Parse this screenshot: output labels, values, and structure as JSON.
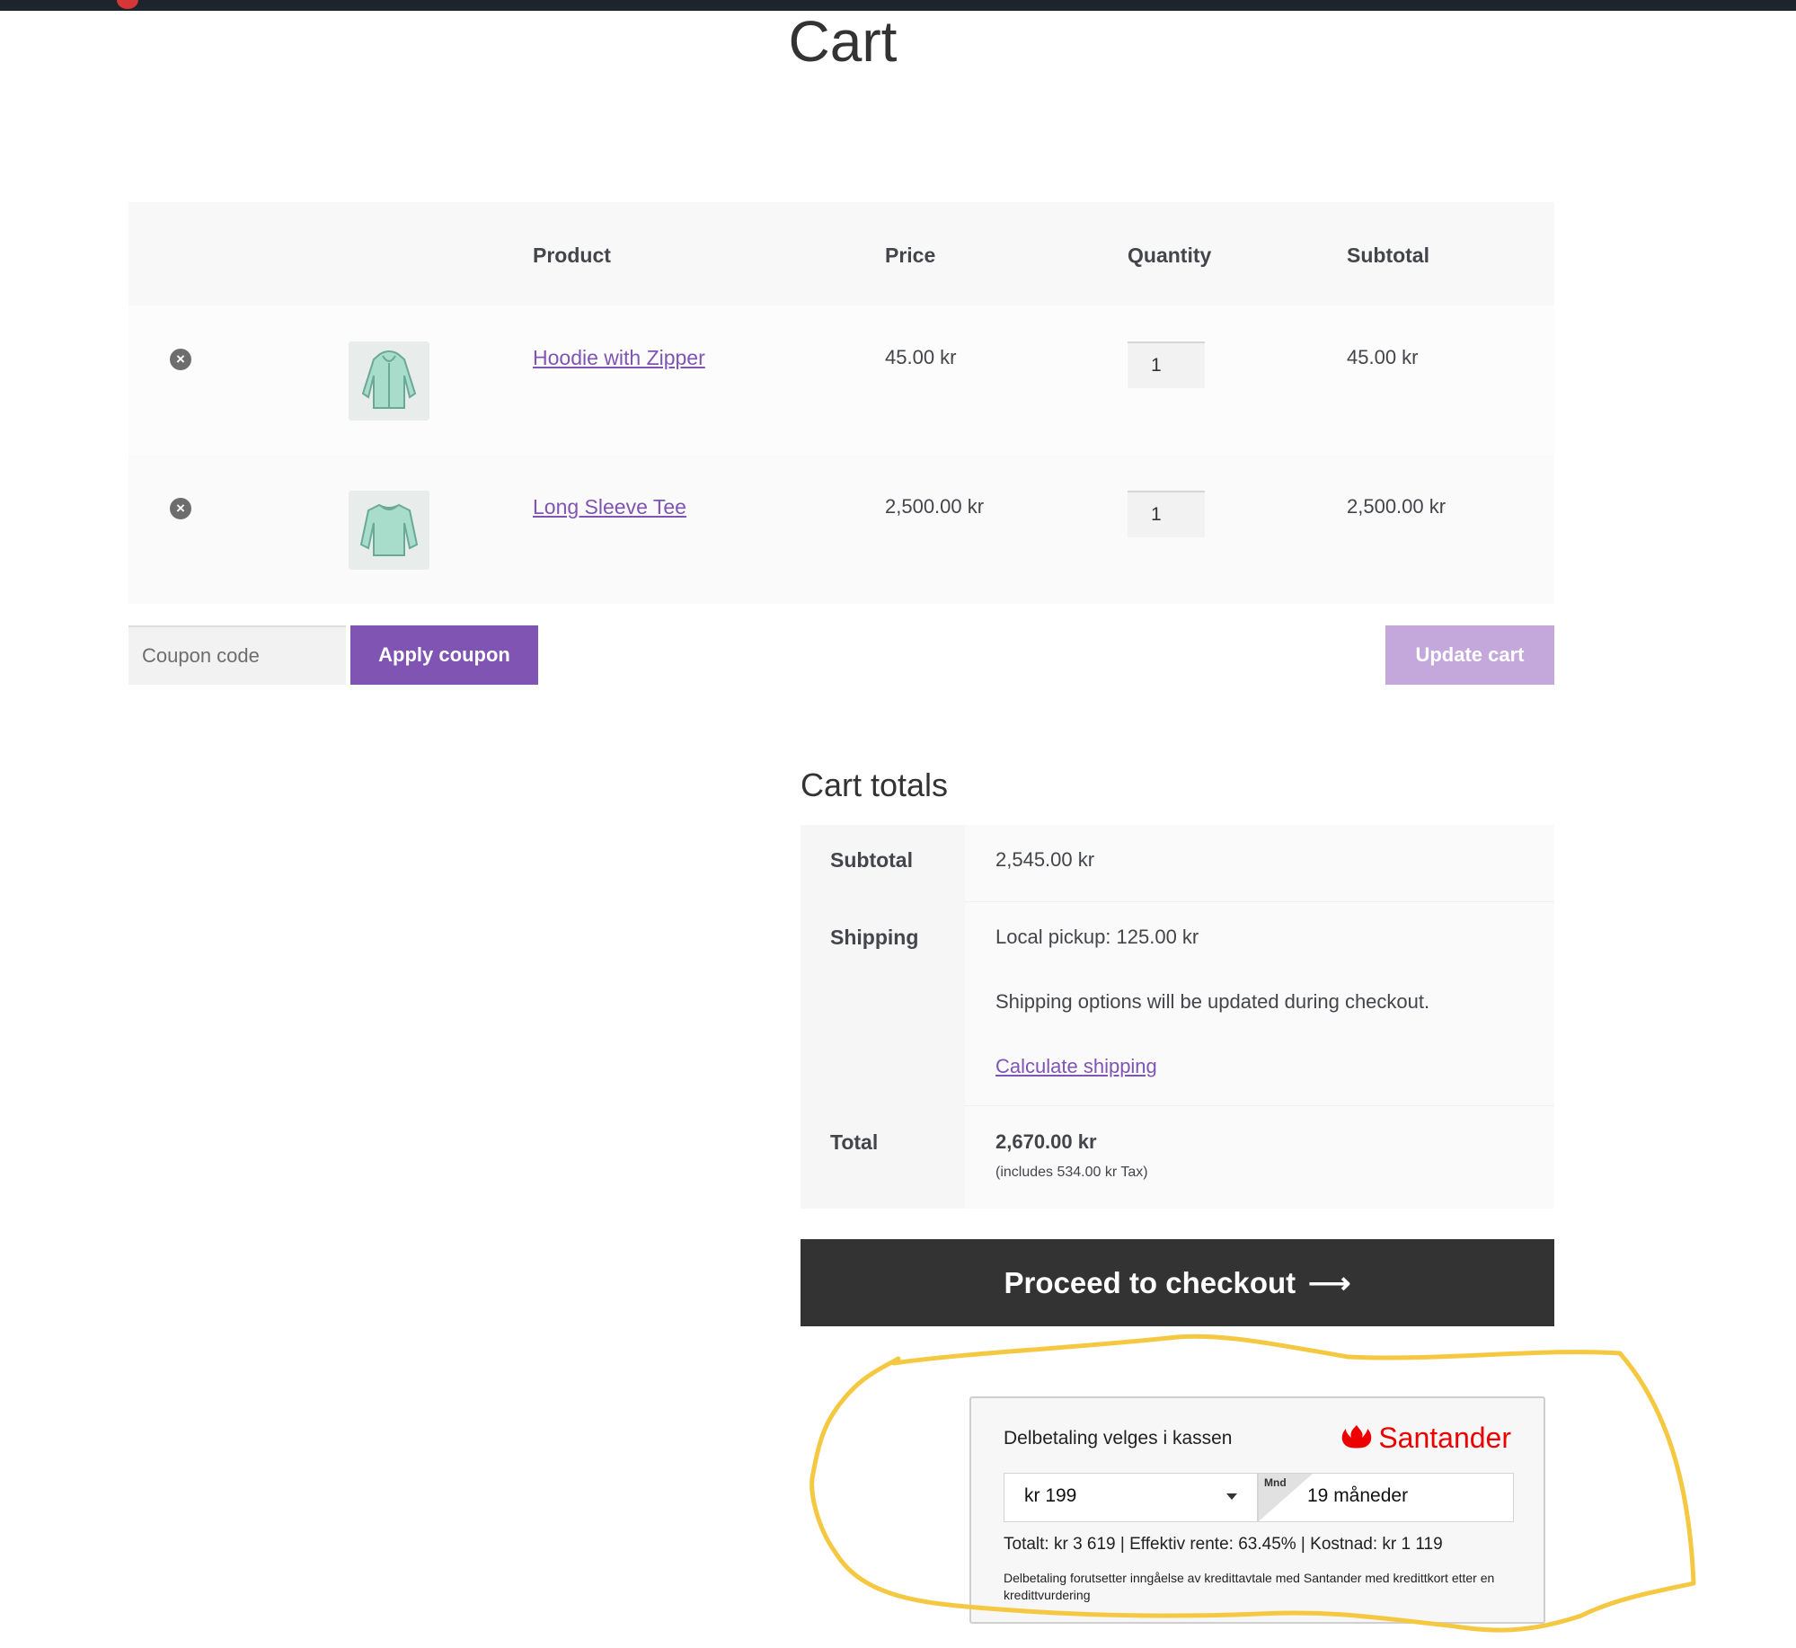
{
  "page": {
    "title": "Cart"
  },
  "cart": {
    "headers": {
      "product": "Product",
      "price": "Price",
      "quantity": "Quantity",
      "subtotal": "Subtotal"
    },
    "items": [
      {
        "name": "Hoodie with Zipper",
        "price": "45.00 kr",
        "quantity": "1",
        "subtotal": "45.00 kr",
        "image_icon": "hoodie-icon"
      },
      {
        "name": "Long Sleeve Tee",
        "price": "2,500.00 kr",
        "quantity": "1",
        "subtotal": "2,500.00 kr",
        "image_icon": "long-sleeve-tee-icon"
      }
    ],
    "remove_glyph": "×"
  },
  "actions": {
    "coupon_placeholder": "Coupon code",
    "apply_label": "Apply coupon",
    "update_label": "Update cart"
  },
  "totals": {
    "title": "Cart totals",
    "subtotal_label": "Subtotal",
    "subtotal_value": "2,545.00 kr",
    "shipping_label": "Shipping",
    "shipping_value": "Local pickup: 125.00 kr",
    "shipping_note": "Shipping options will be updated during checkout.",
    "calculate_link": "Calculate shipping",
    "total_label": "Total",
    "total_value": "2,670.00 kr",
    "tax_note": "(includes 534.00 kr Tax)"
  },
  "checkout": {
    "label": "Proceed to checkout",
    "arrow": "⟶"
  },
  "santander": {
    "title": "Delbetaling velges i kassen",
    "logo_text": "Santander",
    "amount": "kr 199",
    "months_tag": "Mnd",
    "months": "19 måneder",
    "summary": "Totalt: kr 3 619 | Effektiv rente: 63.45% | Kostnad: kr 1 119",
    "disclaimer": "Delbetaling forutsetter inngåelse av kredittavtale med Santander med kredittkort etter en kredittvurdering"
  },
  "colors": {
    "accent": "#7f54b3",
    "accent_light": "#c4a8dc",
    "checkout_bg": "#333333",
    "santander_red": "#ec0000",
    "highlight": "#f5c842"
  }
}
